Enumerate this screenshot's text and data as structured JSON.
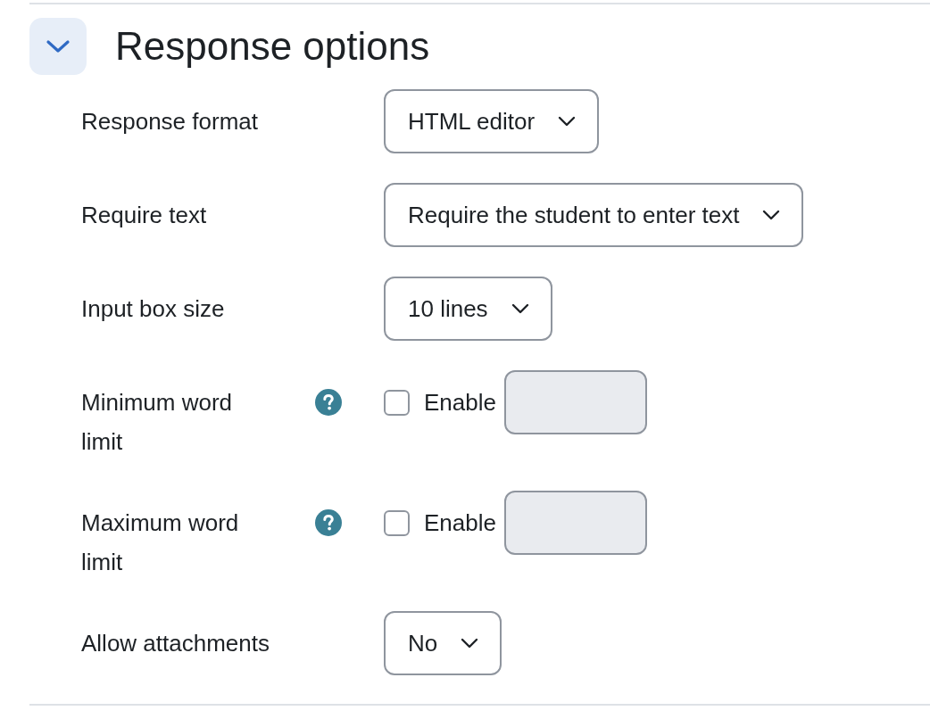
{
  "section": {
    "title": "Response options",
    "expanded": true
  },
  "rows": [
    {
      "kind": "select",
      "label": "Response format",
      "value": "HTML editor"
    },
    {
      "kind": "select",
      "label": "Require text",
      "value": "Require the student to enter text"
    },
    {
      "kind": "select",
      "label": "Input box size",
      "value": "10 lines"
    },
    {
      "kind": "word_limit",
      "label": "Minimum word limit",
      "checkbox_label": "Enable",
      "checked": false,
      "disabled": true
    },
    {
      "kind": "word_limit",
      "label": "Maximum word limit",
      "checkbox_label": "Enable",
      "checked": false,
      "disabled": true
    },
    {
      "kind": "select",
      "label": "Allow attachments",
      "value": "No"
    }
  ]
}
